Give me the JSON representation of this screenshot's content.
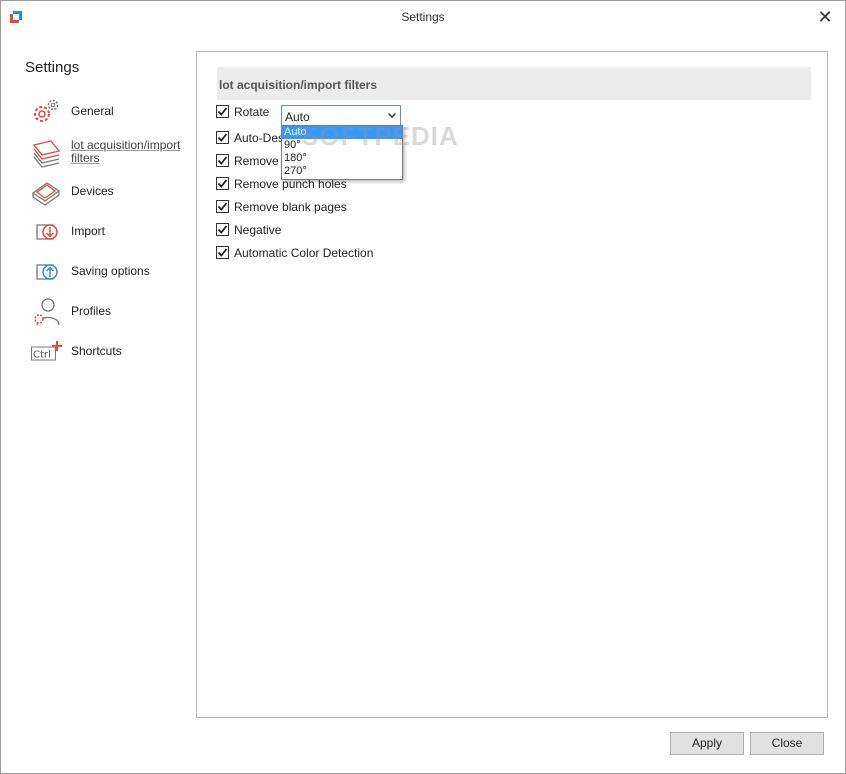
{
  "window": {
    "title": "Settings"
  },
  "sidebar": {
    "heading": "Settings",
    "items": [
      {
        "label": "General",
        "icon": "gear-icon"
      },
      {
        "label": "lot acquisition/import filters",
        "line1": "lot acquisition/import",
        "line2": "filters",
        "icon": "document-stack-icon",
        "active": true
      },
      {
        "label": "Devices",
        "icon": "scanner-icon"
      },
      {
        "label": "Import",
        "icon": "import-icon"
      },
      {
        "label": "Saving options",
        "icon": "saving-icon"
      },
      {
        "label": "Profiles",
        "icon": "profile-icon"
      },
      {
        "label": "Shortcuts",
        "icon": "ctrl-key-icon"
      }
    ]
  },
  "panel": {
    "section_title": "lot acquisition/import filters",
    "options": [
      {
        "label": "Rotate",
        "checked": true
      },
      {
        "label": "Auto-Desk",
        "checked": true
      },
      {
        "label": "Remove b",
        "checked": true
      },
      {
        "label": "Remove punch holes",
        "checked": true
      },
      {
        "label": "Remove blank pages",
        "checked": true
      },
      {
        "label": "Negative",
        "checked": true
      },
      {
        "label": "Automatic Color Detection",
        "checked": true
      }
    ],
    "rotate_select": {
      "value": "Auto",
      "options": [
        "Auto",
        "90°",
        "180°",
        "270°"
      ],
      "highlighted": "Auto"
    },
    "watermark": "SOFTPEDIA"
  },
  "footer": {
    "apply": "Apply",
    "close": "Close"
  },
  "colors": {
    "accent": "#e4483a",
    "selection": "#3399ff"
  }
}
